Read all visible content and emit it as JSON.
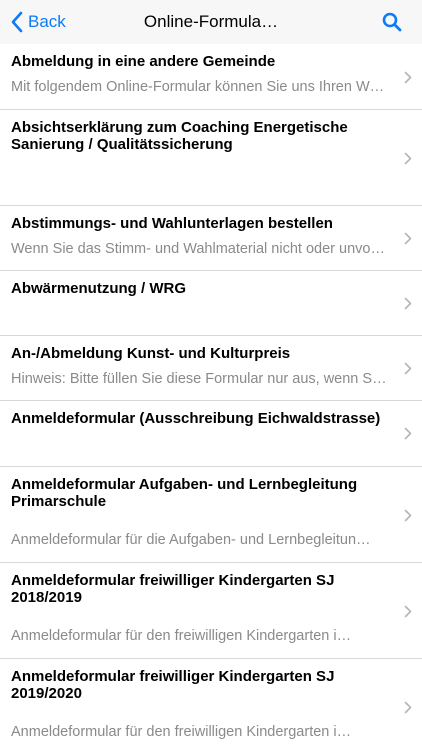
{
  "nav": {
    "back_label": "Back",
    "title": "Online-Formula…",
    "search_icon": "search-icon",
    "accent": "#0b7cf7"
  },
  "items": [
    {
      "title": "Abmeldung in eine andere Gemeinde",
      "subtitle": "Mit folgendem Online-Formular können Sie uns Ihren W…"
    },
    {
      "title": "Absichtserklärung zum Coaching Energetische Sanierung / Qualitätssicherung",
      "subtitle": ""
    },
    {
      "title": "Abstimmungs- und Wahlunterlagen bestellen",
      "subtitle": "Wenn Sie das Stimm- und Wahlmaterial nicht oder unvol…"
    },
    {
      "title": "Abwärmenutzung / WRG",
      "subtitle": ""
    },
    {
      "title": "An-/Abmeldung Kunst- und Kulturpreis",
      "subtitle": "Hinweis: Bitte füllen Sie diese Formular nur aus, wenn Si…"
    },
    {
      "title": "Anmeldeformular (Ausschreibung Eichwaldstrasse)",
      "subtitle": ""
    },
    {
      "title": "Anmeldeformular Aufgaben- und Lernbegleitung Primarschule",
      "subtitle": "Anmeldeformular für die Aufgaben- und Lernbegleitun…"
    },
    {
      "title": "Anmeldeformular freiwilliger Kindergarten SJ 2018/2019",
      "subtitle": "Anmeldeformular für den freiwilligen Kindergarten i…"
    },
    {
      "title": "Anmeldeformular freiwilliger Kindergarten SJ 2019/2020",
      "subtitle": "Anmeldeformular für den freiwilligen Kindergarten i…"
    }
  ]
}
